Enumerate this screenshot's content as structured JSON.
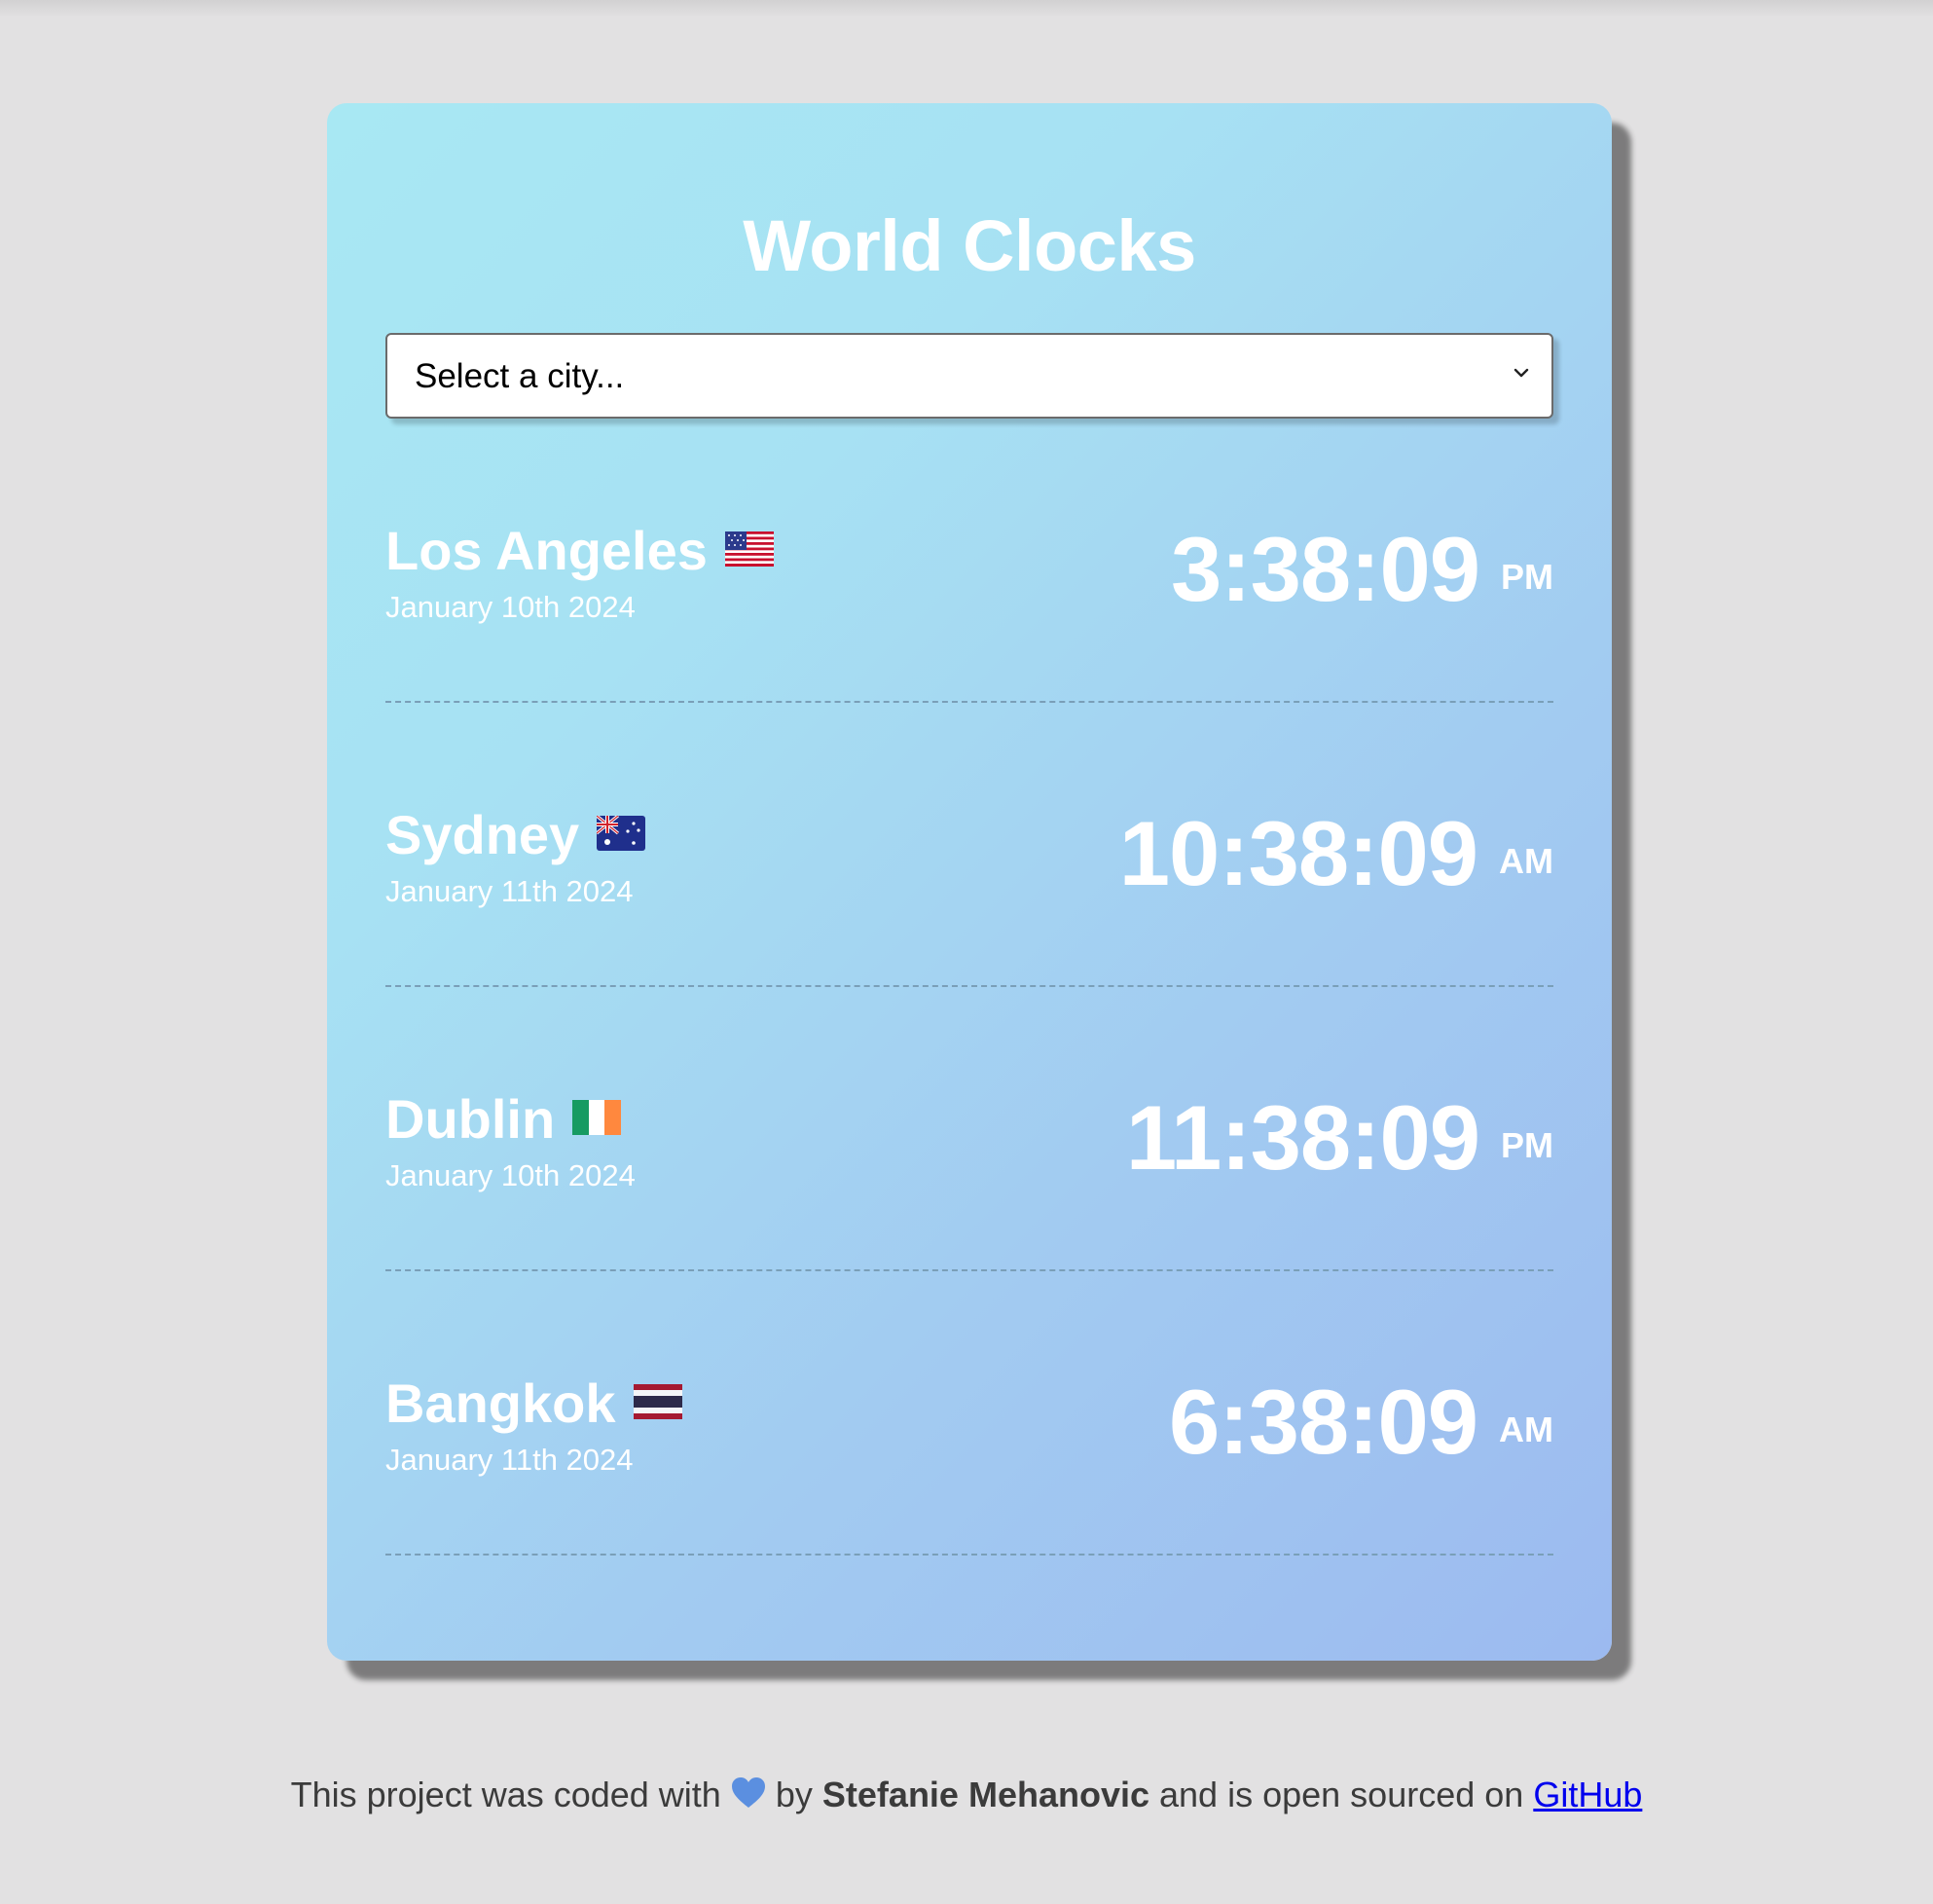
{
  "app": {
    "title": "World Clocks"
  },
  "city_select": {
    "placeholder_option": "Select a city..."
  },
  "cities": [
    {
      "name": "Los Angeles",
      "flag": "us-flag",
      "date": "January 10th 2024",
      "time": "3:38:09",
      "ampm": "PM"
    },
    {
      "name": "Sydney",
      "flag": "australia-flag",
      "date": "January 11th 2024",
      "time": "10:38:09",
      "ampm": "AM"
    },
    {
      "name": "Dublin",
      "flag": "ireland-flag",
      "date": "January 10th 2024",
      "time": "11:38:09",
      "ampm": "PM"
    },
    {
      "name": "Bangkok",
      "flag": "thailand-flag",
      "date": "January 11th 2024",
      "time": "6:38:09",
      "ampm": "AM"
    }
  ],
  "footer": {
    "prefix": "This project was coded with",
    "heart_icon": "blue-heart-icon",
    "by": "by",
    "author": "Stefanie Mehanovic",
    "middle": "and is open sourced on",
    "link_label": "GitHub"
  },
  "colors": {
    "page_background": "#e2e1e2",
    "card_gradient_start": "#a8e8f3",
    "card_gradient_end": "#9cbaf0",
    "text_light": "#ffffff",
    "link": "#0000ee"
  }
}
